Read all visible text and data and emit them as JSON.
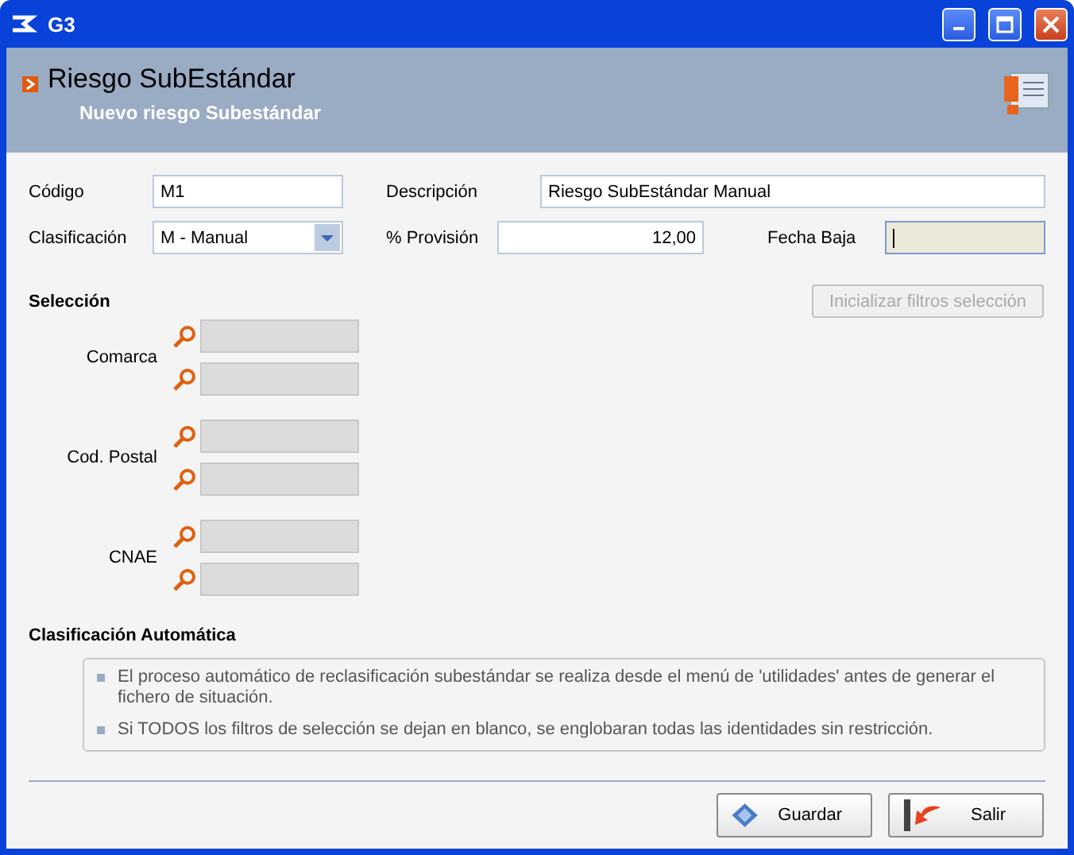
{
  "window": {
    "title": "G3"
  },
  "header": {
    "title": "Riesgo SubEstándar",
    "subtitle": "Nuevo riesgo Subestándar"
  },
  "form": {
    "codigo": {
      "label": "Código",
      "value": "M1"
    },
    "descripcion": {
      "label": "Descripción",
      "value": "Riesgo SubEstándar Manual"
    },
    "clasificacion": {
      "label": "Clasificación",
      "value": "M - Manual"
    },
    "provision": {
      "label": "% Provisión",
      "value": "12,00"
    },
    "fecha_baja": {
      "label": "Fecha Baja",
      "focused": true
    }
  },
  "seleccion": {
    "title": "Selección",
    "reset_button": {
      "label": "Inicializar filtros selección",
      "disabled": true
    },
    "groups": [
      {
        "label": "Comarca",
        "fields": [
          {
            "disabled": true
          },
          {
            "disabled": true
          }
        ]
      },
      {
        "label": "Cod. Postal",
        "fields": [
          {
            "disabled": true
          },
          {
            "disabled": true
          }
        ]
      },
      {
        "label": "CNAE",
        "fields": [
          {
            "disabled": true
          },
          {
            "disabled": true
          }
        ]
      }
    ]
  },
  "clasificacion_automatica": {
    "title": "Clasificación Automática",
    "notes": [
      "El proceso automático de reclasificación subestándar se realiza desde el menú de 'utilidades' antes de generar el fichero de situación.",
      "Si TODOS los filtros de selección se dejan en blanco, se englobaran todas las identidades sin restricción."
    ]
  },
  "buttons": [
    {
      "kind": "save",
      "label": "Guardar"
    },
    {
      "kind": "exit",
      "label": "Salir"
    }
  ]
}
